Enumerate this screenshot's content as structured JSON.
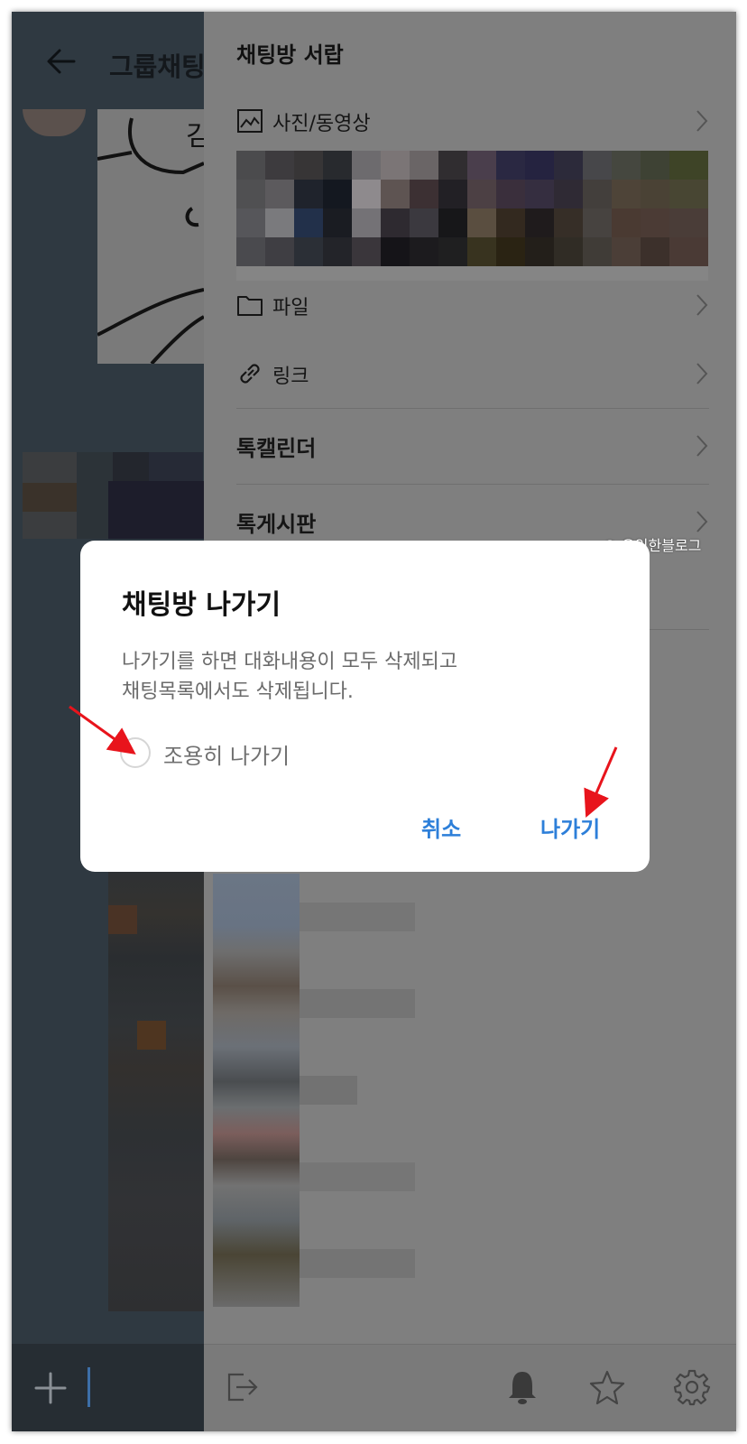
{
  "chat": {
    "title": "그룹채팅",
    "sticker_text": "김"
  },
  "drawer": {
    "title": "채팅방 서랍",
    "items": [
      {
        "label": "사진/동영상",
        "icon": "image-icon"
      },
      {
        "label": "파일",
        "icon": "folder-icon"
      },
      {
        "label": "링크",
        "icon": "link-icon"
      },
      {
        "label": "톡캘린더"
      },
      {
        "label": "톡게시판"
      }
    ],
    "bottom_icons": [
      "exit-icon",
      "bell-icon",
      "star-icon",
      "gear-icon"
    ]
  },
  "dialog": {
    "title": "채팅방 나가기",
    "message_line1": "나가기를 하면 대화내용이 모두 삭제되고",
    "message_line2": "채팅목록에서도 삭제됩니다.",
    "quiet_leave_label": "조용히 나가기",
    "cancel_label": "취소",
    "leave_label": "나가기"
  },
  "watermark": "© 유익한블로그",
  "colors": {
    "accent": "#2d7fd9",
    "annotation_arrow": "#e8141c",
    "overlay": "#7f7f7f"
  }
}
